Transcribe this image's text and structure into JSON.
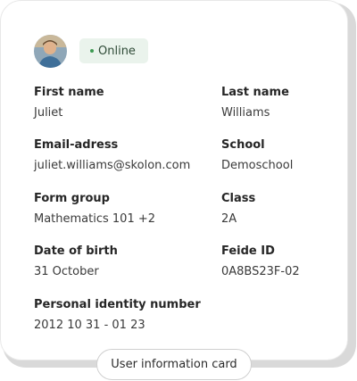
{
  "card": {
    "status": "Online",
    "status_color": "#3d9a52",
    "avatar_icon": "user-photo-avatar",
    "fields": {
      "first_name": {
        "label": "First name",
        "value": "Juliet"
      },
      "last_name": {
        "label": "Last name",
        "value": "Williams"
      },
      "email": {
        "label": "Email-adress",
        "value": "juliet.williams@skolon.com"
      },
      "school": {
        "label": "School",
        "value": "Demoschool"
      },
      "form_group": {
        "label": "Form group",
        "value": "Mathematics 101 +2"
      },
      "class": {
        "label": "Class",
        "value": "2A"
      },
      "date_of_birth": {
        "label": "Date of birth",
        "value": "31 October"
      },
      "feide_id": {
        "label": "Feide ID",
        "value": "0A8BS23F-02"
      },
      "personal_id": {
        "label": "Personal identity number",
        "value": "2012 10 31 - 01 23"
      }
    }
  },
  "caption": "User information card"
}
